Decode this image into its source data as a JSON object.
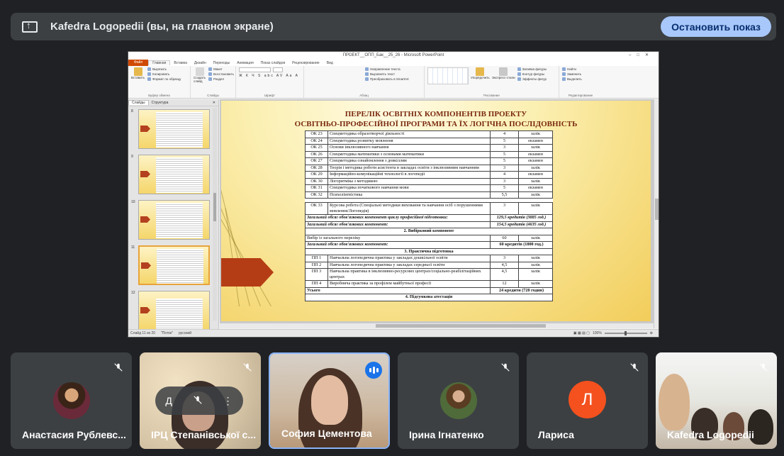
{
  "banner": {
    "text": "Kafedra Logopedii (вы, на главном экране)",
    "stop_label": "Остановить показ"
  },
  "ppt": {
    "window_title": "ПРОЕКТ__ОПП_Бак__25_26 - Microsoft PowerPoint",
    "tabs": [
      "Файл",
      "Главная",
      "Вставка",
      "Дизайн",
      "Переходы",
      "Анимация",
      "Показ слайдов",
      "Рецензирование",
      "Вид"
    ],
    "ribbon": {
      "paste": "Вставить",
      "cut": "Вырезать",
      "copy": "Копировать",
      "format_painter": "Формат по образцу",
      "clipboard": "Буфер обмена",
      "new_slide": "Создать слайд",
      "layout": "Макет",
      "reset": "Восстановить",
      "section": "Раздел",
      "slides": "Слайды",
      "font": "Шрифт",
      "paragraph": "Абзац",
      "text_direction": "Направление текста",
      "align_text": "Выровнять текст",
      "smartart": "Преобразовать в SmartArt",
      "arrange": "Упорядочить",
      "quick_styles": "Экспресс-стили",
      "shape_fill": "Заливка фигуры",
      "shape_outline": "Контур фигуры",
      "shape_effects": "Эффекты фигур",
      "drawing": "Рисование",
      "find": "Найти",
      "replace": "Заменить",
      "select": "Выделить",
      "editing": "Редактирование"
    },
    "pane_tabs": [
      "Слайды",
      "Структура"
    ],
    "thumbs": [
      {
        "num": "8"
      },
      {
        "num": "9"
      },
      {
        "num": "10"
      },
      {
        "num": "11"
      },
      {
        "num": "12"
      }
    ],
    "status": {
      "slide": "Слайд 11 из 20",
      "theme": "\"Поток\"",
      "lang": "русский",
      "zoom": "100%"
    }
  },
  "slide": {
    "title_line1": "ПЕРЕЛІК ОСВІТНІХ КОМПОНЕНТІВ ПРОЕКТУ",
    "title_line2": "ОСВІТНЬО-ПРОФЕСІЙНОЇ ПРОГРАМИ ТА ЇХ ЛОГІЧНА ПОСЛІДОВНІСТЬ",
    "rows_a": [
      {
        "code": "ОК 23",
        "name": "Спецметодика образотворчої діяльності",
        "credits": "4",
        "form": "залік"
      },
      {
        "code": "ОК 24",
        "name": "Спецметодика розвитку мовлення",
        "credits": "5",
        "form": "екзамен"
      },
      {
        "code": "ОК 25",
        "name": "Основи інклюзивного навчання",
        "credits": "3",
        "form": "залік"
      },
      {
        "code": "ОК 26",
        "name": "Спецметодика математики з основами математики",
        "credits": "5",
        "form": "екзамен"
      },
      {
        "code": "ОК 27",
        "name": "Спецметодика ознайомлення з довкіллям",
        "credits": "5",
        "form": "екзамен"
      },
      {
        "code": "ОК 28",
        "name": "Теорія і методика роботи асистента в закладах освіти з інклюзивним навчанням",
        "credits": "3",
        "form": "залік"
      },
      {
        "code": "ОК 29",
        "name": "Інформаційно-комунікаційні технології в логопедії",
        "credits": "4",
        "form": "екзамен"
      },
      {
        "code": "ОК 30",
        "name": "Логоритміка з методикою",
        "credits": "3",
        "form": "залік"
      },
      {
        "code": "ОК 31",
        "name": "Спецметодика початкового навчання мови",
        "credits": "5",
        "form": "екзамен"
      },
      {
        "code": "ОК 32",
        "name": "Психолінгвістика",
        "credits": "5,5",
        "form": "залік"
      }
    ],
    "row_33": {
      "code": "ОК 33",
      "name": "Курсова робота (Спеціальні методики виховання та навчання осіб з порушеннями мовлення/Логопедія)",
      "credits": "3",
      "form": "залік"
    },
    "total_prof": {
      "label": "Загальний обсяг обов'язкових компонент циклу професійної підготовки:",
      "value": "129,5 кредитів (3885 год.)"
    },
    "total_mandatory": {
      "label": "Загальний обсяг обов'язкових компонент:",
      "value": "154,5 кредитів (4635 год.)"
    },
    "section2": "2.  Вибірковий компонент",
    "elective_row": {
      "name": "Вибір із загального переліку",
      "credits": "60",
      "form": "залік"
    },
    "total_elective": {
      "label": "Загальний обсяг обов'язкових компонент:",
      "value": "60 кредитів (1800 год.)"
    },
    "section3": "3.  Практична підготовка",
    "practice_rows": [
      {
        "code": "ПП 1",
        "name": "Навчальна логопедична практика у закладах дошкільної освіти",
        "credits": "3",
        "form": "залік"
      },
      {
        "code": "ПП 2",
        "name": "Навчальна логопедична практика у закладах середньої освіти",
        "credits": "4,5",
        "form": "залік"
      },
      {
        "code": "ПП 3",
        "name": "Навчальна практика в інклюзивно-ресурсних центрах/соціально-реабілітаційних центрах",
        "credits": "4,5",
        "form": "залік"
      },
      {
        "code": "ПП 4",
        "name": "Виробнича практика за профілем майбутньої професії",
        "credits": "12",
        "form": "залік"
      }
    ],
    "total_practice": {
      "label": "Усього",
      "value": "24 кредити (720 годин)"
    },
    "section4": "4.  Підсумкова атестація"
  },
  "participants": [
    {
      "name": "Анастасия Рублевская",
      "display": "Анастасия Рублевс..."
    },
    {
      "name": "ІРЦ Степанівської с...",
      "display": "ІРЦ Степанівської с..."
    },
    {
      "name": "София Цементова",
      "display": "София Цементова"
    },
    {
      "name": "Ірина Ігнатенко",
      "display": "Ірина Ігнатенко"
    },
    {
      "name": "Лариса",
      "display": "Лариса",
      "initial": "Л"
    },
    {
      "name": "Kafedra Logopedii",
      "display": "Kafedra Logopedii"
    }
  ],
  "overlay": {
    "pin": "Д",
    "more": "⋮"
  },
  "colors": {
    "stop_btn": "#a8c7fa",
    "speaking": "#1a73e8",
    "lariса_avatar": "#f4511e",
    "slide_arrow": "#b53d15"
  }
}
